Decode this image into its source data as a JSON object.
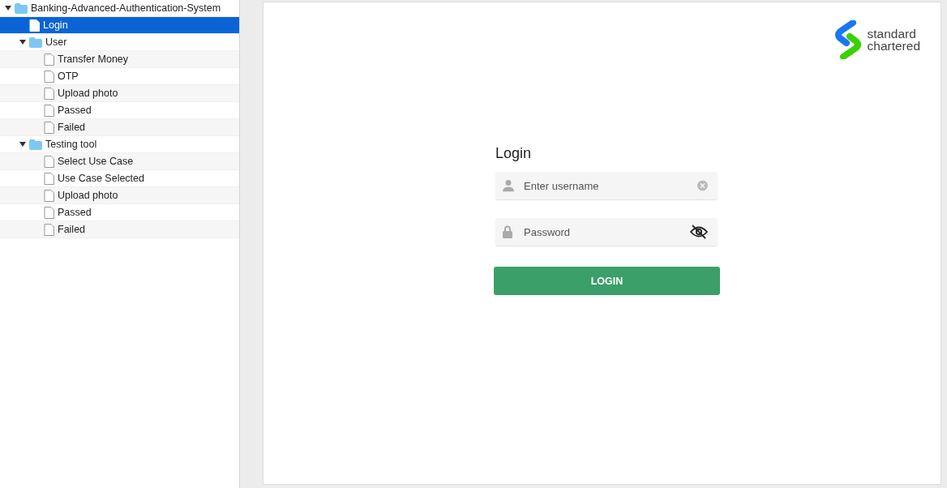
{
  "sidebar": {
    "tree": [
      {
        "label": "Banking-Advanced-Authentication-System",
        "kind": "folder",
        "expanded": true,
        "selected": false,
        "children": [
          {
            "label": "Login",
            "kind": "file",
            "selected": true
          },
          {
            "label": "User",
            "kind": "folder",
            "expanded": true,
            "selected": false,
            "children": [
              {
                "label": "Transfer Money",
                "kind": "file",
                "selected": false
              },
              {
                "label": "OTP",
                "kind": "file",
                "selected": false
              },
              {
                "label": "Upload photo",
                "kind": "file",
                "selected": false
              },
              {
                "label": "Passed",
                "kind": "file",
                "selected": false
              },
              {
                "label": "Failed",
                "kind": "file",
                "selected": false
              }
            ]
          },
          {
            "label": "Testing tool",
            "kind": "folder",
            "expanded": true,
            "selected": false,
            "children": [
              {
                "label": "Select Use Case",
                "kind": "file",
                "selected": false
              },
              {
                "label": "Use Case Selected",
                "kind": "file",
                "selected": false
              },
              {
                "label": "Upload photo",
                "kind": "file",
                "selected": false
              },
              {
                "label": "Passed",
                "kind": "file",
                "selected": false
              },
              {
                "label": "Failed",
                "kind": "file",
                "selected": false
              }
            ]
          }
        ]
      }
    ]
  },
  "artboard": {
    "logo": {
      "lines": [
        "standard",
        "chartered"
      ]
    },
    "login": {
      "title": "Login",
      "username": {
        "placeholder": "Enter username"
      },
      "password": {
        "placeholder": "Password"
      },
      "button": "LOGIN"
    }
  }
}
